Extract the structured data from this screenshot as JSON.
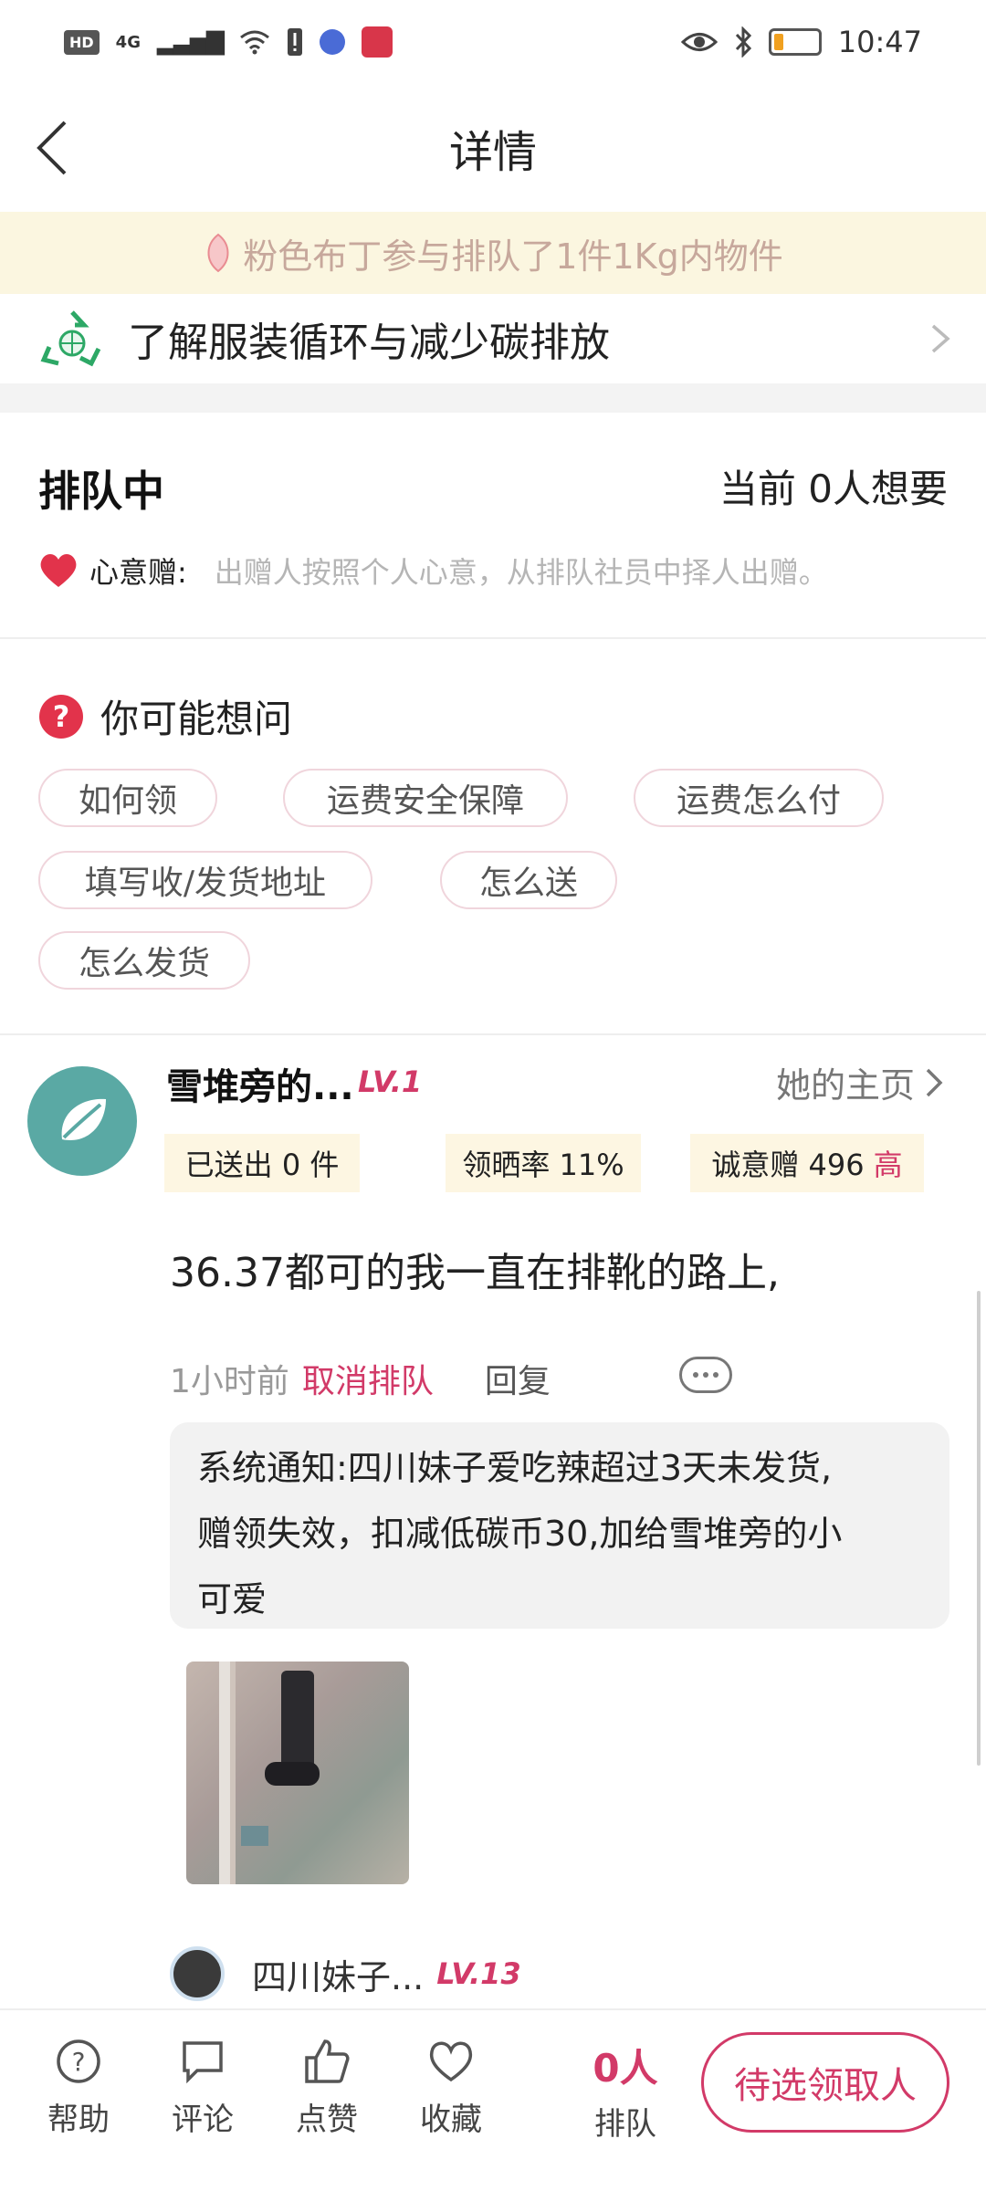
{
  "status_bar": {
    "network_badge": "HD",
    "network_type": "4G",
    "time": "10:47"
  },
  "header": {
    "title": "详情"
  },
  "banner": {
    "text": "粉色布丁参与排队了1件1Kg内物件"
  },
  "carbon_link": {
    "label": "了解服装循环与减少碳排放"
  },
  "queue": {
    "status": "排队中",
    "count_text": "当前 0人想要",
    "intent_label": "心意赠:",
    "intent_desc": "出赠人按照个人心意，从排队社员中择人出赠。"
  },
  "faq": {
    "title": "你可能想问",
    "chips": [
      "如何领",
      "运费安全保障",
      "运费怎么付",
      "填写收/发货地址",
      "怎么送",
      "怎么发货"
    ]
  },
  "comment": {
    "user_name": "雪堆旁的...",
    "user_level": "LV.1",
    "her_page": "她的主页",
    "stats": {
      "sent": "已送出 0 件",
      "review_rate": "领晒率 11%",
      "sincerity": "诚意赠 496",
      "sincerity_level": "高"
    },
    "text": "36.37都可的我一直在排靴的路上,",
    "time": "1小时前",
    "cancel": "取消排队",
    "reply": "回复",
    "notice_lines": [
      "系统通知:四川妹子爱吃辣超过3天未发货,",
      "赠领失效，扣减低碳币30,加给雪堆旁的小",
      "可爱"
    ],
    "reply_user": "四川妹子...",
    "reply_level": "LV.13"
  },
  "bottom_bar": {
    "help": "帮助",
    "comment": "评论",
    "like": "点赞",
    "favorite": "收藏",
    "queue_count": "0人",
    "queue_label": "排队",
    "pick_button": "待选领取人"
  },
  "colors": {
    "accent": "#d23a68",
    "banner_bg": "#fbf6e0",
    "stat_bg": "#fdf6e2",
    "teal": "#5aa9a4"
  }
}
